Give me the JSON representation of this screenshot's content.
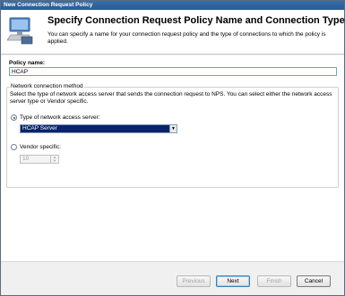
{
  "window": {
    "title": "New Connection Request Policy"
  },
  "header": {
    "title": "Specify Connection Request Policy Name and Connection Type",
    "description": "You can specify a name for your connection request policy and the type of connections to which the policy is applied."
  },
  "policy_name": {
    "label": "Policy name:",
    "value": "HCAP"
  },
  "network_method": {
    "legend": "Network connection method",
    "description": "Select the type of network access server that sends the connection request to NPS. You can select either the network access server type or Vendor specific.",
    "type_option": {
      "label": "Type of network access server:",
      "checked": true
    },
    "type_select": {
      "value": "HCAP Server"
    },
    "vendor_option": {
      "label": "Vendor specific:",
      "checked": false
    },
    "vendor_value": "10"
  },
  "buttons": {
    "previous": "Previous",
    "next": "Next",
    "finish": "Finish",
    "cancel": "Cancel"
  },
  "colors": {
    "title_bar": "#2a5a94",
    "selection": "#0a246a"
  }
}
